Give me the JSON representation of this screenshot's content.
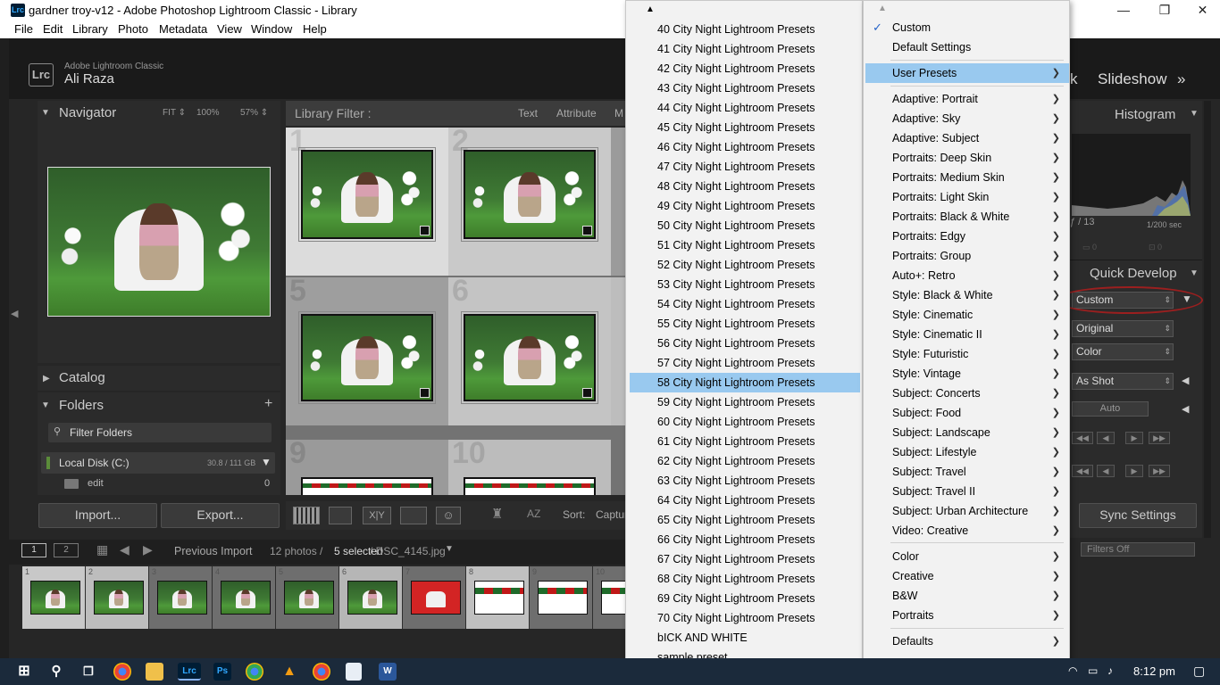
{
  "window": {
    "title": "gardner troy-v12 - Adobe Photoshop Lightroom Classic - Library",
    "logo": "Lrc"
  },
  "menubar": [
    "File",
    "Edit",
    "Library",
    "Photo",
    "Metadata",
    "View",
    "Window",
    "Help"
  ],
  "header": {
    "brand": "Adobe Lightroom Classic",
    "user": "Ali Raza",
    "lrc": "Lrc",
    "modules": [
      "k",
      "Slideshow",
      "»"
    ]
  },
  "navigator": {
    "title": "Navigator",
    "fit": "FIT ⇕",
    "zoom1": "100%",
    "zoom2": "57% ⇕"
  },
  "catalog": {
    "title": "Catalog"
  },
  "folders": {
    "title": "Folders",
    "filter_placeholder": "Filter Folders",
    "disk": "Local Disk (C:)",
    "disk_size": "30.8 / 111 GB",
    "folder": "edit",
    "folder_count": "0"
  },
  "buttons": {
    "import": "Import...",
    "export": "Export..."
  },
  "library_filter": {
    "title": "Library Filter :",
    "text": "Text",
    "attribute": "Attribute",
    "metadata": "M"
  },
  "grid": {
    "cell_numbers": [
      "1",
      "2",
      "5",
      "6",
      "9",
      "10"
    ]
  },
  "toolbar": {
    "sort_label": "Sort:",
    "sort_value": "Captur",
    "xy": "X|Y"
  },
  "filmstrip_bar": {
    "page1": "1",
    "page2": "2",
    "source": "Previous Import",
    "count": "12 photos /",
    "selected": "5 selected",
    "file": "/ DSC_4145.jpg",
    "filter_label": "Filters Off"
  },
  "filmstrip_numbers": [
    "1",
    "2",
    "3",
    "4",
    "5",
    "6",
    "7",
    "8",
    "9",
    "10"
  ],
  "right_panel": {
    "histogram": "Histogram",
    "aperture": "ƒ / 13",
    "shutter": "1/200 sec",
    "quick_develop": "Quick Develop",
    "saved_preset": "Custom",
    "crop_ratio": "Original",
    "treatment": "Color",
    "white_balance": "As Shot",
    "auto": "Auto",
    "sync": "Sync Settings"
  },
  "presets_list": [
    "40 City Night Lightroom Presets",
    "41 City Night Lightroom Presets",
    "42 City Night Lightroom Presets",
    "43 City Night Lightroom Presets",
    "44 City Night Lightroom Presets",
    "45 City Night Lightroom Presets",
    "46 City Night Lightroom Presets",
    "47 City Night Lightroom Presets",
    "48 City Night Lightroom Presets",
    "49 City Night Lightroom Presets",
    "50 City Night Lightroom Presets",
    "51 City Night Lightroom Presets",
    "52 City Night Lightroom Presets",
    "53 City Night Lightroom Presets",
    "54 City Night Lightroom Presets",
    "55 City Night Lightroom Presets",
    "56 City Night Lightroom Presets",
    "57 City Night Lightroom Presets",
    "58 City Night Lightroom Presets",
    "59 City Night Lightroom Presets",
    "60 City Night Lightroom Presets",
    "61 City Night Lightroom Presets",
    "62 City Night Lightroom Presets",
    "63 City Night Lightroom Presets",
    "64 City Night Lightroom Presets",
    "65 City Night Lightroom Presets",
    "66 City Night Lightroom Presets",
    "67 City Night Lightroom Presets",
    "68 City Night Lightroom Presets",
    "69 City Night Lightroom Presets",
    "70 City Night Lightroom Presets",
    "bICK AND WHITE",
    "sample preset"
  ],
  "presets_list_selected": "58 City Night Lightroom Presets",
  "preset_menu": {
    "top": [
      "Custom",
      "Default Settings"
    ],
    "user_presets": "User Presets",
    "groups": [
      "Adaptive: Portrait",
      "Adaptive: Sky",
      "Adaptive: Subject",
      "Portraits: Deep Skin",
      "Portraits: Medium Skin",
      "Portraits: Light Skin",
      "Portraits: Black & White",
      "Portraits: Edgy",
      "Portraits: Group",
      "Auto+: Retro",
      "Style: Black & White",
      "Style: Cinematic",
      "Style: Cinematic II",
      "Style: Futuristic",
      "Style: Vintage",
      "Subject: Concerts",
      "Subject: Food",
      "Subject: Landscape",
      "Subject: Lifestyle",
      "Subject: Travel",
      "Subject: Travel II",
      "Subject: Urban Architecture",
      "Video: Creative"
    ],
    "groups2": [
      "Color",
      "Creative",
      "B&W",
      "Portraits"
    ],
    "defaults": "Defaults"
  },
  "taskbar": {
    "time": "8:12 pm",
    "ps": "Ps",
    "lrc": "Lrc",
    "word": "W"
  },
  "colors": {
    "menu_highlight": "#99c9ef",
    "annotation": "#9b1f1f",
    "taskbar": "#1b2a3b"
  }
}
